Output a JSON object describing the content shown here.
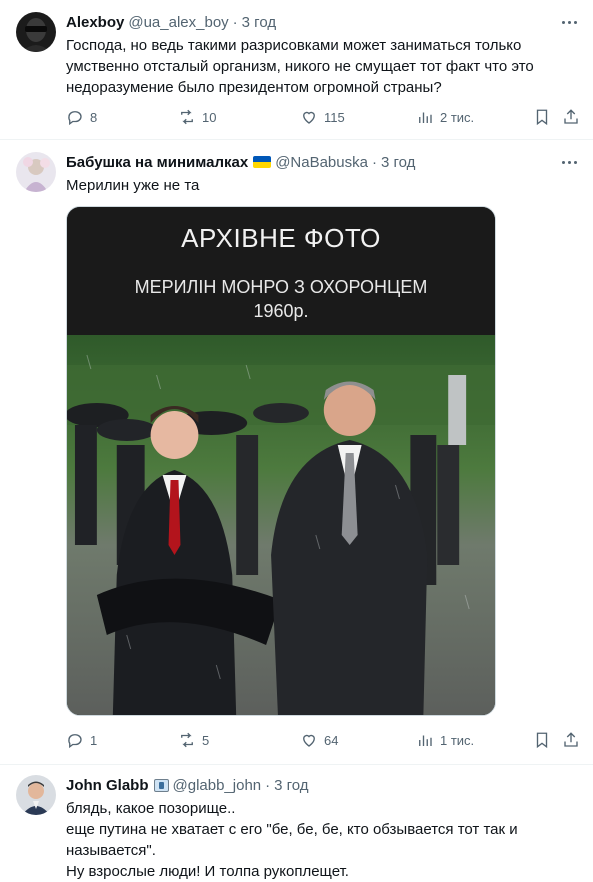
{
  "posts": [
    {
      "display_name": "Alexboy",
      "handle": "@ua_alex_boy",
      "time": "3 год",
      "text": [
        "Господа, но ведь такими разрисовками может заниматься только умственно отсталый организм, никого не смущает тот факт что это недоразумение было президентом огромной страны?"
      ],
      "replies": "8",
      "reposts": "10",
      "likes": "115",
      "views": "2 тис."
    },
    {
      "display_name": "Бабушка на минималках",
      "handle": "@NaBabuska",
      "time": "3 год",
      "text": [
        "Мерилин уже не та"
      ],
      "image": {
        "caption_title": "АРХІВНЕ ФОТО",
        "caption_line1": "МЕРИЛІН МОНРО З ОХОРОНЦЕМ",
        "caption_line2": "1960р."
      },
      "replies": "1",
      "reposts": "5",
      "likes": "64",
      "views": "1 тис."
    },
    {
      "display_name": "John Glabb",
      "handle": "@glabb_john",
      "time": "3 год",
      "text": [
        "блядь, какое позорище..",
        "еще путина не хватает с его \"бе, бе, бе, кто обзывается тот так и называется\".",
        "Ну взрослые люди! И толпа рукоплещет."
      ]
    }
  ],
  "separator": "·",
  "icons": {
    "reply": "reply-icon",
    "repost": "repost-icon",
    "like": "heart-icon",
    "views": "views-icon",
    "bookmark": "bookmark-icon",
    "share": "share-icon",
    "more": "more-icon"
  },
  "colors": {
    "text": "#0f1419",
    "secondary": "#536471",
    "border": "#eff3f4"
  }
}
